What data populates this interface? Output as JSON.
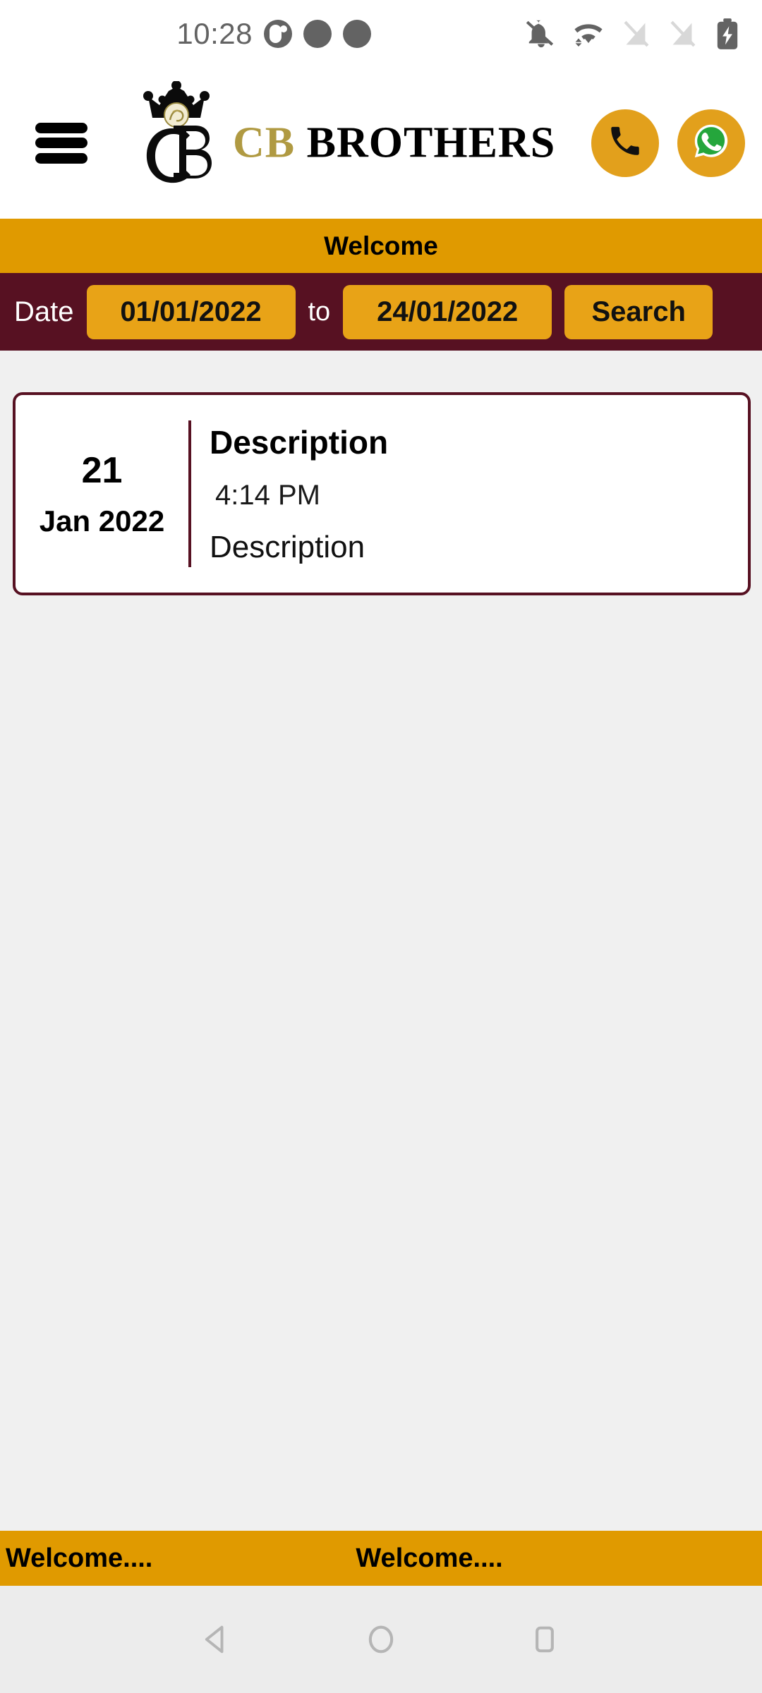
{
  "status_bar": {
    "clock": "10:28",
    "notification_icons": [
      "split-circle-icon",
      "dot-icon",
      "dot-icon"
    ],
    "system_icons": [
      "bell-off-icon",
      "wifi-icon",
      "sim-off-icon",
      "sim-off-icon",
      "battery-charging-icon"
    ],
    "icon_color": "#636363",
    "background": "#ffffff"
  },
  "header": {
    "menu_icon": "hamburger-menu-icon",
    "logo_alt": "crown-cb-monogram-logo",
    "brand_gold": "CB ",
    "brand_black": "BROTHERS",
    "gold_color": "#b09a42",
    "call_button_label": "phone-icon",
    "whatsapp_button_label": "whatsapp-icon",
    "action_button_color": "#e2a01c",
    "background": "#ffffff"
  },
  "welcome_banner": {
    "text": "Welcome",
    "background": "#e09a00",
    "text_color": "#000000"
  },
  "date_bar": {
    "label": "Date",
    "from_value": "01/01/2022",
    "to_label": "to",
    "to_value": "24/01/2022",
    "search_label": "Search",
    "background": "#571122",
    "chip_color": "#e8a317"
  },
  "notices": [
    {
      "day": "21",
      "month_year": "Jan 2022",
      "title": "Description",
      "time": "4:14 PM",
      "description": "Description"
    }
  ],
  "ticker": {
    "item_a": "Welcome....",
    "item_b": "Welcome....",
    "background": "#e09a00"
  },
  "nav_bar": {
    "back_icon": "back-triangle-icon",
    "home_icon": "home-circle-icon",
    "recents_icon": "recents-square-icon",
    "background": "#ececec",
    "icon_color": "#b5b5b5"
  },
  "theme": {
    "page_background": "#f0f0f0",
    "accent_orange": "#e09a00",
    "accent_maroon": "#571122"
  }
}
